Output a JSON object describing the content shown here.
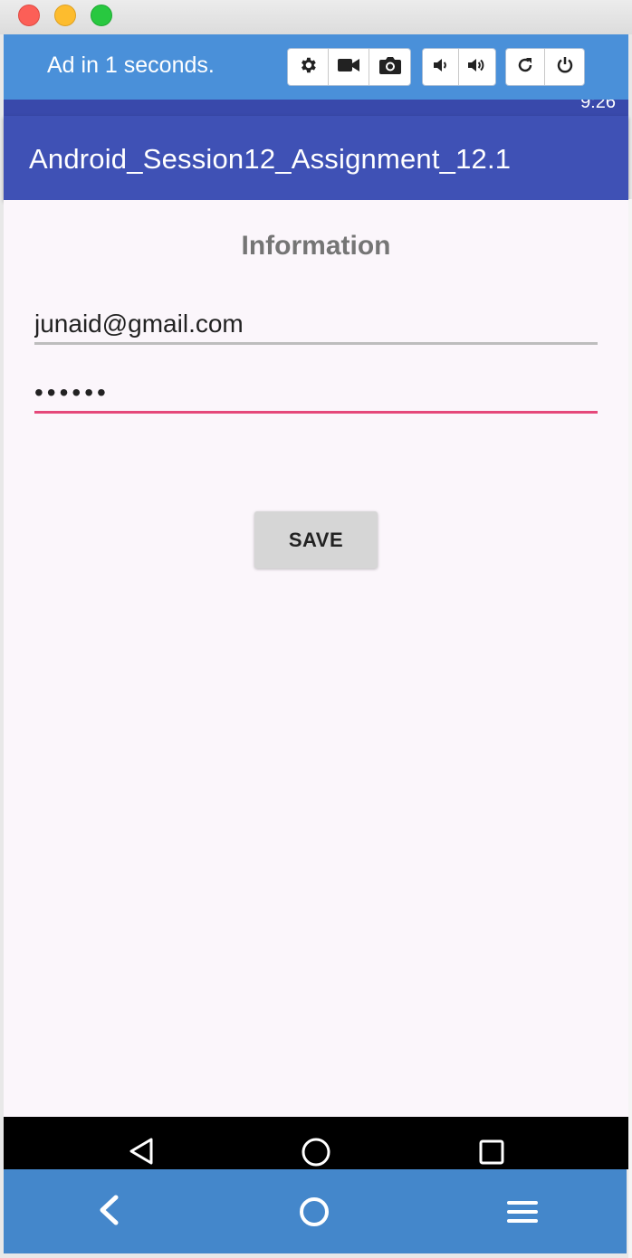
{
  "titlebar": {
    "buttons": [
      "close",
      "minimize",
      "maximize"
    ]
  },
  "emulator_toolbar": {
    "ad_text": "Ad in 1 seconds.",
    "icons": [
      "settings-icon",
      "video-camera-icon",
      "camera-icon",
      "volume-down-icon",
      "volume-up-icon",
      "rotate-icon",
      "power-icon"
    ]
  },
  "status_bar": {
    "time": "9:26"
  },
  "app_bar": {
    "title": "Android_Session12_Assignment_12.1"
  },
  "form": {
    "heading": "Information",
    "email_value": "junaid@gmail.com",
    "password_value": "••••••",
    "save_label": "SAVE"
  },
  "nav_bar": {
    "icons": [
      "back-triangle-icon",
      "home-circle-icon",
      "recents-square-icon"
    ]
  },
  "emulator_bottom": {
    "icons": [
      "back-chevron-icon",
      "home-circle-icon",
      "menu-icon"
    ]
  },
  "colors": {
    "emulator_blue": "#4a90d9",
    "app_bar": "#3f51b5",
    "status_bar": "#3949ab",
    "accent_underline": "#e5487a",
    "content_bg": "#fbf6fb"
  }
}
